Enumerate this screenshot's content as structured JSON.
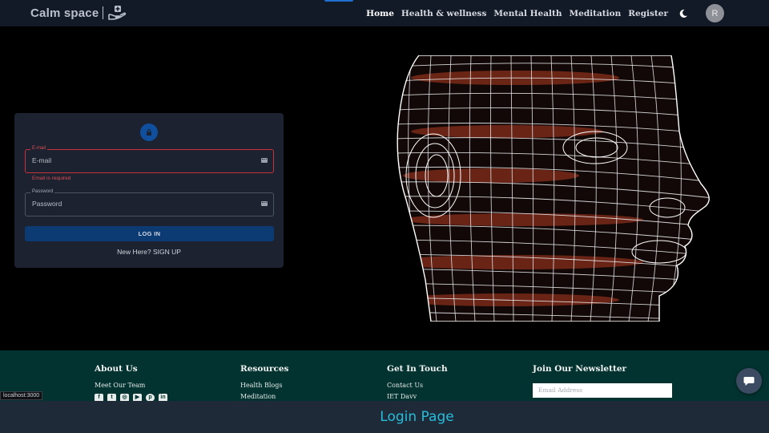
{
  "navbar": {
    "brand_text": "Calm space",
    "links": [
      "Home",
      "Health & wellness",
      "Mental Health",
      "Meditation",
      "Register"
    ],
    "avatar_initial": "R",
    "theme_icon": "moon-icon"
  },
  "login": {
    "lock_icon": "lock-icon",
    "email": {
      "label": "E-mail",
      "placeholder": "E-mail",
      "value": "",
      "error": "Email is required"
    },
    "password": {
      "label": "Password",
      "placeholder": "Password",
      "value": ""
    },
    "submit_label": "LOG IN",
    "signup_text": "New Here? SIGN UP"
  },
  "footer": {
    "about": {
      "heading": "About Us",
      "links": [
        "Meet Our Team"
      ],
      "socials": [
        "facebook-icon",
        "twitter-icon",
        "instagram-icon",
        "youtube-icon",
        "pinterest-icon",
        "linkedin-icon"
      ]
    },
    "resources": {
      "heading": "Resources",
      "links": [
        "Health Blogs",
        "Meditation"
      ]
    },
    "contact": {
      "heading": "Get In Touch",
      "links": [
        "Contact Us",
        "IET Davv"
      ]
    },
    "newsletter": {
      "heading": "Join Our Newsletter",
      "placeholder": "Email Address"
    },
    "chat_icon": "chat-icon"
  },
  "status_url": "localhost:3000",
  "caption": "Login Page",
  "colors": {
    "navbar_bg": "#131a27",
    "card_bg": "#1c2230",
    "error": "#d94c53",
    "primary_button": "#0c3b74",
    "footer_bg": "#033330",
    "caption_bg": "#1e2a38",
    "caption_text": "#26bddb"
  }
}
